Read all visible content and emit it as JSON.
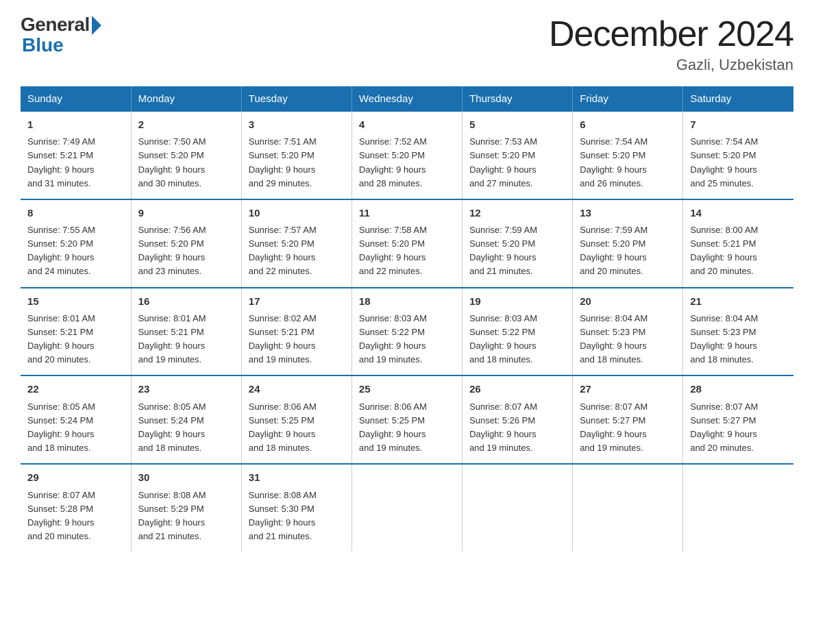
{
  "logo": {
    "general": "General",
    "blue": "Blue"
  },
  "title": "December 2024",
  "subtitle": "Gazli, Uzbekistan",
  "days_of_week": [
    "Sunday",
    "Monday",
    "Tuesday",
    "Wednesday",
    "Thursday",
    "Friday",
    "Saturday"
  ],
  "weeks": [
    [
      {
        "day": "1",
        "info": "Sunrise: 7:49 AM\nSunset: 5:21 PM\nDaylight: 9 hours\nand 31 minutes."
      },
      {
        "day": "2",
        "info": "Sunrise: 7:50 AM\nSunset: 5:20 PM\nDaylight: 9 hours\nand 30 minutes."
      },
      {
        "day": "3",
        "info": "Sunrise: 7:51 AM\nSunset: 5:20 PM\nDaylight: 9 hours\nand 29 minutes."
      },
      {
        "day": "4",
        "info": "Sunrise: 7:52 AM\nSunset: 5:20 PM\nDaylight: 9 hours\nand 28 minutes."
      },
      {
        "day": "5",
        "info": "Sunrise: 7:53 AM\nSunset: 5:20 PM\nDaylight: 9 hours\nand 27 minutes."
      },
      {
        "day": "6",
        "info": "Sunrise: 7:54 AM\nSunset: 5:20 PM\nDaylight: 9 hours\nand 26 minutes."
      },
      {
        "day": "7",
        "info": "Sunrise: 7:54 AM\nSunset: 5:20 PM\nDaylight: 9 hours\nand 25 minutes."
      }
    ],
    [
      {
        "day": "8",
        "info": "Sunrise: 7:55 AM\nSunset: 5:20 PM\nDaylight: 9 hours\nand 24 minutes."
      },
      {
        "day": "9",
        "info": "Sunrise: 7:56 AM\nSunset: 5:20 PM\nDaylight: 9 hours\nand 23 minutes."
      },
      {
        "day": "10",
        "info": "Sunrise: 7:57 AM\nSunset: 5:20 PM\nDaylight: 9 hours\nand 22 minutes."
      },
      {
        "day": "11",
        "info": "Sunrise: 7:58 AM\nSunset: 5:20 PM\nDaylight: 9 hours\nand 22 minutes."
      },
      {
        "day": "12",
        "info": "Sunrise: 7:59 AM\nSunset: 5:20 PM\nDaylight: 9 hours\nand 21 minutes."
      },
      {
        "day": "13",
        "info": "Sunrise: 7:59 AM\nSunset: 5:20 PM\nDaylight: 9 hours\nand 20 minutes."
      },
      {
        "day": "14",
        "info": "Sunrise: 8:00 AM\nSunset: 5:21 PM\nDaylight: 9 hours\nand 20 minutes."
      }
    ],
    [
      {
        "day": "15",
        "info": "Sunrise: 8:01 AM\nSunset: 5:21 PM\nDaylight: 9 hours\nand 20 minutes."
      },
      {
        "day": "16",
        "info": "Sunrise: 8:01 AM\nSunset: 5:21 PM\nDaylight: 9 hours\nand 19 minutes."
      },
      {
        "day": "17",
        "info": "Sunrise: 8:02 AM\nSunset: 5:21 PM\nDaylight: 9 hours\nand 19 minutes."
      },
      {
        "day": "18",
        "info": "Sunrise: 8:03 AM\nSunset: 5:22 PM\nDaylight: 9 hours\nand 19 minutes."
      },
      {
        "day": "19",
        "info": "Sunrise: 8:03 AM\nSunset: 5:22 PM\nDaylight: 9 hours\nand 18 minutes."
      },
      {
        "day": "20",
        "info": "Sunrise: 8:04 AM\nSunset: 5:23 PM\nDaylight: 9 hours\nand 18 minutes."
      },
      {
        "day": "21",
        "info": "Sunrise: 8:04 AM\nSunset: 5:23 PM\nDaylight: 9 hours\nand 18 minutes."
      }
    ],
    [
      {
        "day": "22",
        "info": "Sunrise: 8:05 AM\nSunset: 5:24 PM\nDaylight: 9 hours\nand 18 minutes."
      },
      {
        "day": "23",
        "info": "Sunrise: 8:05 AM\nSunset: 5:24 PM\nDaylight: 9 hours\nand 18 minutes."
      },
      {
        "day": "24",
        "info": "Sunrise: 8:06 AM\nSunset: 5:25 PM\nDaylight: 9 hours\nand 18 minutes."
      },
      {
        "day": "25",
        "info": "Sunrise: 8:06 AM\nSunset: 5:25 PM\nDaylight: 9 hours\nand 19 minutes."
      },
      {
        "day": "26",
        "info": "Sunrise: 8:07 AM\nSunset: 5:26 PM\nDaylight: 9 hours\nand 19 minutes."
      },
      {
        "day": "27",
        "info": "Sunrise: 8:07 AM\nSunset: 5:27 PM\nDaylight: 9 hours\nand 19 minutes."
      },
      {
        "day": "28",
        "info": "Sunrise: 8:07 AM\nSunset: 5:27 PM\nDaylight: 9 hours\nand 20 minutes."
      }
    ],
    [
      {
        "day": "29",
        "info": "Sunrise: 8:07 AM\nSunset: 5:28 PM\nDaylight: 9 hours\nand 20 minutes."
      },
      {
        "day": "30",
        "info": "Sunrise: 8:08 AM\nSunset: 5:29 PM\nDaylight: 9 hours\nand 21 minutes."
      },
      {
        "day": "31",
        "info": "Sunrise: 8:08 AM\nSunset: 5:30 PM\nDaylight: 9 hours\nand 21 minutes."
      },
      {
        "day": "",
        "info": ""
      },
      {
        "day": "",
        "info": ""
      },
      {
        "day": "",
        "info": ""
      },
      {
        "day": "",
        "info": ""
      }
    ]
  ]
}
